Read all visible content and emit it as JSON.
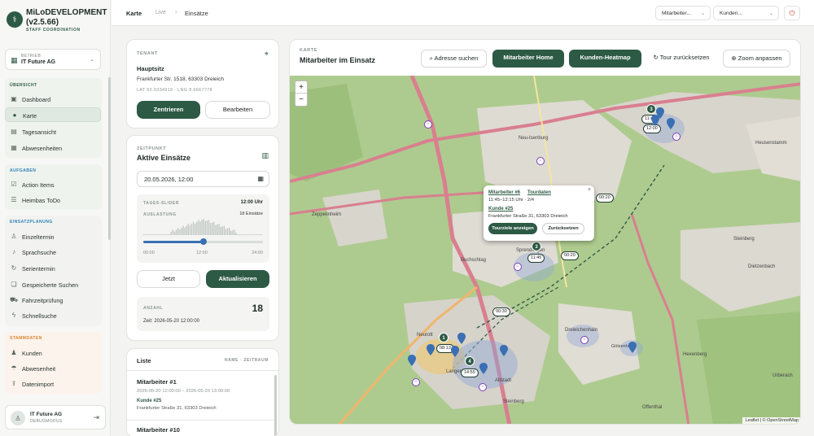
{
  "app": {
    "title": "MiLoDEVELOPMENT (v2.5.66)",
    "subtitle": "STAFF COORDINATION"
  },
  "betrieb": {
    "label": "BETRIEB",
    "value": "IT Future AG"
  },
  "nav": {
    "ubersicht": {
      "title": "ÜBERSICHT",
      "items": [
        "Dashboard",
        "Karte",
        "Tagesansicht",
        "Abwesenheiten"
      ]
    },
    "aufgaben": {
      "title": "AUFGABEN",
      "items": [
        "Action Items",
        "Heimbas ToDo"
      ]
    },
    "einsatz": {
      "title": "EINSATZPLANUNG",
      "items": [
        "Einzeltermin",
        "Sprachsuche",
        "Serientermin",
        "Gespeicherte Suchen",
        "Fahrzeitprüfung",
        "Schnellsuche"
      ]
    },
    "stamm": {
      "title": "STAMMDATEN",
      "items": [
        "Kunden",
        "Abwesenheit",
        "Datenimport"
      ]
    }
  },
  "user": {
    "name": "IT Future AG",
    "role": "DEBUGMODUS"
  },
  "breadcrumb": {
    "root": "Karte",
    "live": "Live",
    "sep": "›",
    "current": "Einsätze"
  },
  "topbar": {
    "select1": "Mitarbeiter...",
    "select2": "Kunden..."
  },
  "tenant": {
    "label": "TENANT",
    "name": "Hauptsitz",
    "address": "Frankfurter Str. 1518, 63303 Dreieich",
    "coords": "LAT 50.0334919 · LNG 8.6667778",
    "center_btn": "Zentrieren",
    "edit_btn": "Bearbeiten"
  },
  "zeitpunkt": {
    "label": "ZEITPUNKT",
    "title": "Aktive Einsätze",
    "datetime": "20.05.2026, 12:00",
    "slider_label": "TAGES-SLIDER",
    "slider_time": "12:00 Uhr",
    "load_label": "AUSLASTUNG",
    "load_count": "18 Einsätze",
    "slider_value": 0.5,
    "ticks": [
      "00:00",
      "12:00",
      "24:00"
    ],
    "now_btn": "Jetzt",
    "update_btn": "Aktualisieren",
    "anzahl_label": "ANZAHL",
    "anzahl_value": "18",
    "zeit_text": "Zeit: 2026-05-20 12:00:00"
  },
  "liste": {
    "title": "Liste",
    "sort": "NAME · ZEITRAUM",
    "items": [
      {
        "name": "Mitarbeiter #1",
        "time": "2026-05-20 12:00:00 – 2026-05-20 13:00:00",
        "kunde": "Kunde #25",
        "addr": "Frankfurter Straße 31, 63303 Dreieich"
      },
      {
        "name": "Mitarbeiter #10"
      }
    ]
  },
  "map": {
    "label": "KARTE",
    "title": "Mitarbeiter im Einsatz",
    "btn_address": "Adresse suchen",
    "btn_home": "Mitarbeiter Home",
    "btn_heat": "Kunden-Heatmap",
    "btn_tour": "Tour zurücksetzen",
    "btn_zoom": "Zoom anpassen",
    "zoom_in": "+",
    "zoom_out": "−",
    "attribution": "Leaflet | © OpenStreetMap",
    "places": [
      "Neu-Isenburg",
      "Heusenstamm",
      "Zeppelinheim",
      "Buchschlag",
      "Sprendlingen",
      "Dreieichenhain",
      "Götzenhain",
      "Dietzenbach",
      "Steinberg",
      "Neurott",
      "Offenthal",
      "Hexenberg",
      "Urberach",
      "Altstadt",
      "Langen",
      "Steinberg"
    ],
    "time_labels": [
      "00:20",
      "00:20",
      "00:30",
      "11:45",
      "11:45",
      "12:00",
      "08:13",
      "14:55"
    ],
    "clusters": [
      "3",
      "3",
      "1",
      "4"
    ],
    "popup": {
      "mitarbeiter": "Mitarbeiter #6",
      "tourdaten": "Tourdaten",
      "time": "11:45–12:15 Uhr · 2/4",
      "kunde": "Kunde #25",
      "addr": "Frankfurter Straße 31, 63303 Dreieich",
      "btn_show": "Tourziele anzeigen",
      "btn_reset": "Zurücksetzen",
      "close": "×"
    }
  },
  "colors": {
    "primary": "#2d5a45",
    "heat": "#7a3fb8",
    "pin": "#3a6fb3"
  }
}
